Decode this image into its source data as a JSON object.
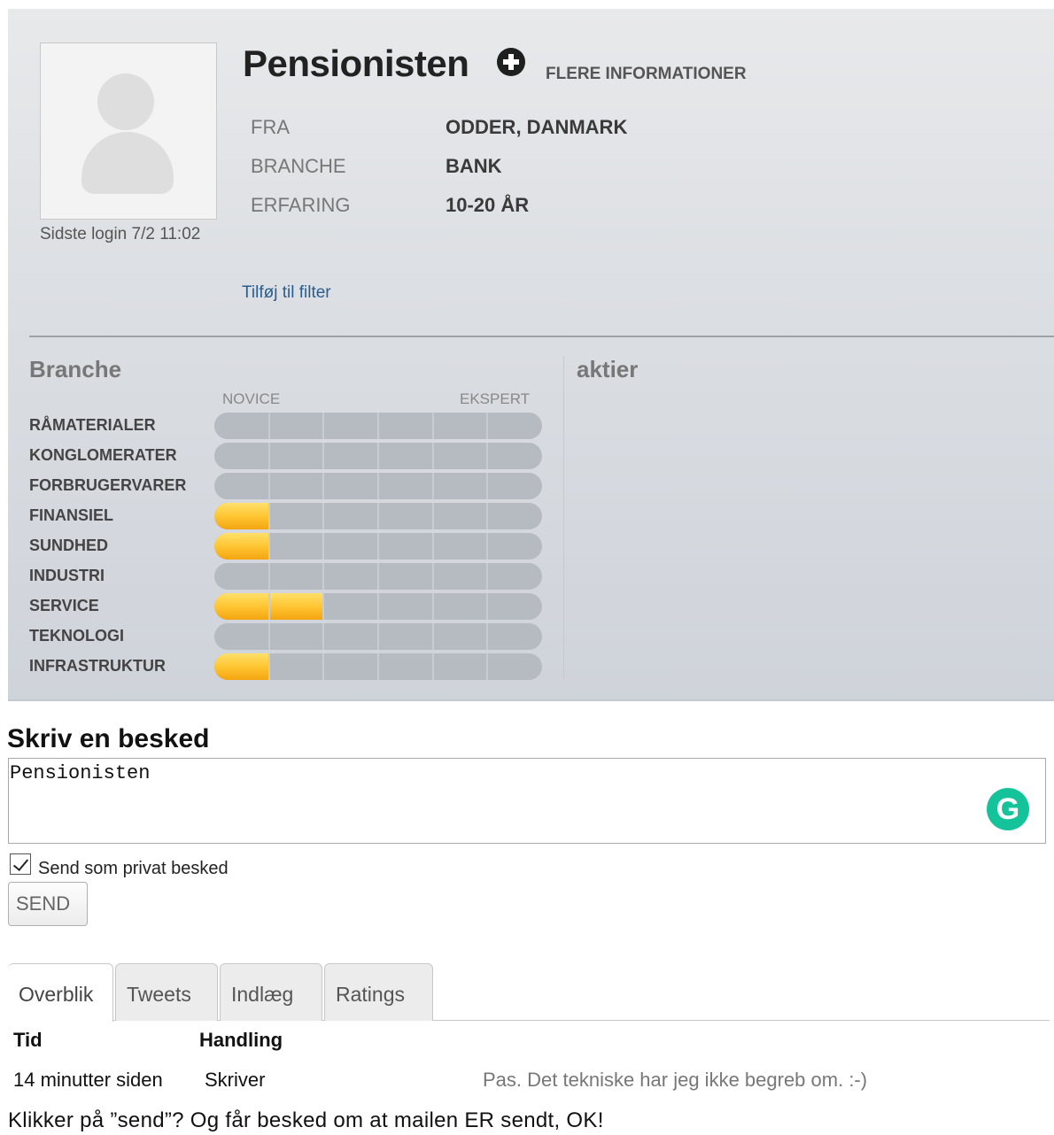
{
  "profile": {
    "name": "Pensionisten",
    "more_info": "FLERE INFORMATIONER",
    "last_login": "Sidste login 7/2 11:02",
    "add_to_filter": "Tilføj til filter",
    "fields": [
      {
        "key": "FRA",
        "value": "ODDER, DANMARK"
      },
      {
        "key": "BRANCHE",
        "value": "BANK"
      },
      {
        "key": "ERFARING",
        "value": "10-20 ÅR"
      }
    ]
  },
  "sections": {
    "branche_title": "Branche",
    "aktier_title": "aktier",
    "scale_min": "NOVICE",
    "scale_max": "EKSPERT"
  },
  "skills": {
    "max_level": 6,
    "items": [
      {
        "name": "RÅMATERIALER",
        "level": 0
      },
      {
        "name": "KONGLOMERATER",
        "level": 0
      },
      {
        "name": "FORBRUGERVARER",
        "level": 0
      },
      {
        "name": "FINANSIEL",
        "level": 1
      },
      {
        "name": "SUNDHED",
        "level": 1
      },
      {
        "name": "INDUSTRI",
        "level": 0
      },
      {
        "name": "SERVICE",
        "level": 2
      },
      {
        "name": "TEKNOLOGI",
        "level": 0
      },
      {
        "name": "INFRASTRUKTUR",
        "level": 1
      }
    ]
  },
  "message": {
    "title": "Skriv en besked",
    "text": "Pensionisten",
    "private_label": "Send som privat besked",
    "private_checked": true,
    "send_label": "SEND",
    "grammarly_icon": "G"
  },
  "tabs": [
    "Overblik",
    "Tweets",
    "Indlæg",
    "Ratings"
  ],
  "activity": {
    "headers": {
      "time": "Tid",
      "action": "Handling"
    },
    "rows": [
      {
        "time": "14 minutter siden",
        "action": "Skriver",
        "text": "Pas. Det tekniske har jeg ikke begreb om. :-)"
      }
    ]
  },
  "caption": "Klikker på ”send”? Og får besked om at mailen ER sendt, OK!",
  "colors": {
    "fill": "#ffc533",
    "bar": "#b6bbc2",
    "link": "#2a5d8f",
    "grammarly": "#15c39a"
  }
}
